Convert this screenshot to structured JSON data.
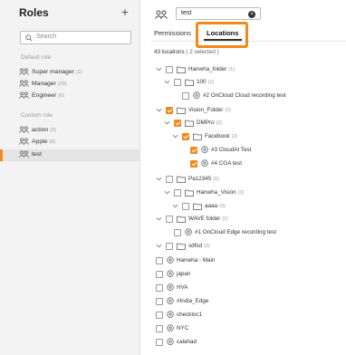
{
  "sidebar": {
    "title": "Roles",
    "add_label": "+",
    "search_placeholder": "Search",
    "default_section": "Default role",
    "custom_section": "Custom role",
    "default_roles": [
      {
        "name": "Super manager",
        "count": "(1)"
      },
      {
        "name": "Manager",
        "count": "(20)"
      },
      {
        "name": "Engineer",
        "count": "(6)"
      }
    ],
    "custom_roles": [
      {
        "name": "action",
        "count": "(0)"
      },
      {
        "name": "Apple",
        "count": "(0)"
      },
      {
        "name": "test",
        "count": ""
      }
    ],
    "selected_role": "test"
  },
  "header": {
    "search_value": "test",
    "clear_label": "×"
  },
  "tabs": [
    {
      "label": "Permissions",
      "active": false
    },
    {
      "label": "Locations",
      "active": true
    }
  ],
  "locations": {
    "count_text": "43 locations",
    "selected_text": "( 2 selected )",
    "tree": [
      {
        "label": "Hanwha_folder",
        "count": "(1)",
        "type": "folder",
        "checked": false,
        "expandable": true
      },
      {
        "label": "100",
        "count": "(1)",
        "type": "folder",
        "checked": false,
        "expandable": true
      },
      {
        "label": "#2 OnCloud Cloud recording test",
        "count": "",
        "type": "location",
        "checked": false,
        "expandable": false
      },
      {
        "label": "Vision_Folder",
        "count": "(2)",
        "type": "folder",
        "checked": true,
        "expandable": true
      },
      {
        "label": "DMPro",
        "count": "(2)",
        "type": "folder",
        "checked": true,
        "expandable": true
      },
      {
        "label": "Facebook",
        "count": "(2)",
        "type": "folder",
        "checked": true,
        "expandable": true
      },
      {
        "label": "#3 CloudAI Test",
        "count": "",
        "type": "location",
        "checked": true,
        "expandable": false
      },
      {
        "label": "#4 CGA test",
        "count": "",
        "type": "location",
        "checked": true,
        "expandable": false
      },
      {
        "label": "Pa12345",
        "count": "(0)",
        "type": "folder",
        "checked": false,
        "expandable": true
      },
      {
        "label": "Hanwha_Vision",
        "count": "(0)",
        "type": "folder",
        "checked": false,
        "expandable": true
      },
      {
        "label": "aaaa",
        "count": "(0)",
        "type": "folder",
        "checked": false,
        "expandable": true
      },
      {
        "label": "WAVE folder",
        "count": "(1)",
        "type": "folder",
        "checked": false,
        "expandable": true
      },
      {
        "label": "#1 OnCloud Edge recording test",
        "count": "",
        "type": "location",
        "checked": false,
        "expandable": false
      },
      {
        "label": "sdfsd",
        "count": "(0)",
        "type": "folder",
        "checked": false,
        "expandable": true
      },
      {
        "label": "Hanwha - Main",
        "count": "",
        "type": "location",
        "checked": false,
        "expandable": false
      },
      {
        "label": "japan",
        "count": "",
        "type": "location",
        "checked": false,
        "expandable": false
      },
      {
        "label": "HVA",
        "count": "",
        "type": "location",
        "checked": false,
        "expandable": false
      },
      {
        "label": "#India_Edge",
        "count": "",
        "type": "location",
        "checked": false,
        "expandable": false
      },
      {
        "label": "checkloc1",
        "count": "",
        "type": "location",
        "checked": false,
        "expandable": false
      },
      {
        "label": "NYC",
        "count": "",
        "type": "location",
        "checked": false,
        "expandable": false
      },
      {
        "label": "calahad",
        "count": "",
        "type": "location",
        "checked": false,
        "expandable": false
      }
    ]
  },
  "colors": {
    "accent": "#f28a1b",
    "sidebar_bg": "#f3f3f3"
  }
}
